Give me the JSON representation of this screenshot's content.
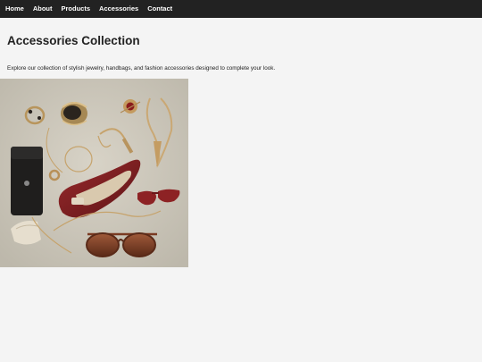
{
  "nav": {
    "items": [
      {
        "label": "Home"
      },
      {
        "label": "About"
      },
      {
        "label": "Products"
      },
      {
        "label": "Accessories"
      },
      {
        "label": "Contact"
      }
    ]
  },
  "main": {
    "title": "Accessories Collection",
    "description": "Explore our collection of stylish jewelry, handbags, and fashion accessories designed to complete your look."
  },
  "colors": {
    "nav_bg": "#222222",
    "page_bg": "#f4f4f4",
    "photo_bg": "#ccc7bb",
    "burgundy": "#7a1f22",
    "gold": "#c8a56a"
  }
}
